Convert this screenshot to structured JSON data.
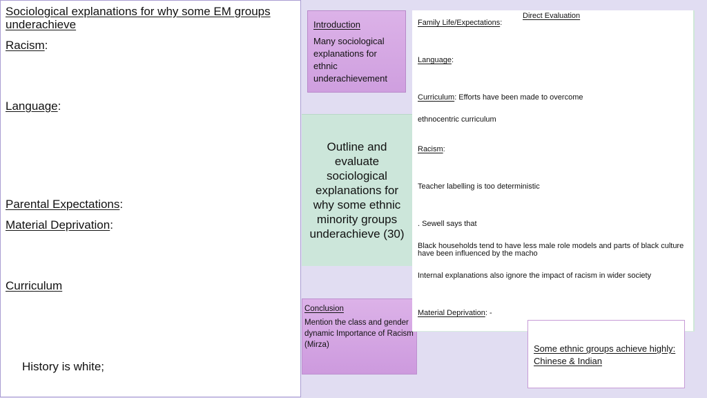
{
  "left_panel": {
    "title": "Sociological explanations for why some EM groups underachieve",
    "sections": [
      {
        "label": "Racism",
        "suffix": ":"
      },
      {
        "label": "Language",
        "suffix": ":"
      },
      {
        "label": "Parental Expectations",
        "suffix": ":"
      },
      {
        "label": "Material Deprivation",
        "suffix": ":"
      },
      {
        "label": "Curriculum",
        "suffix": ""
      }
    ],
    "note": "History is white;"
  },
  "introduction": {
    "title": "Introduction",
    "body": "Many sociological explanations for ethnic underachievement"
  },
  "question": {
    "text": "Outline and evaluate sociological explanations for why some ethnic minority groups underachieve (30)"
  },
  "conclusion": {
    "title": "Conclusion",
    "body": "Mention the class and gender dynamic Importance of Racism (Mirza)"
  },
  "evaluation": {
    "heading": "Direct Evaluation",
    "family_label": "Family Life/Expectations",
    "family_suffix": ":",
    "language_label": "Language",
    "language_suffix": ":",
    "curriculum_label": "Curriculum",
    "curriculum_text": ": Efforts have been made to overcome",
    "curriculum_cont": "ethnocentric curriculum",
    "racism_label": "Racism",
    "racism_suffix": ":",
    "teacher_text": "Teacher labelling is too deterministic",
    "sewell_text": ". Sewell says that",
    "black_text": "Black households tend to have less male role models and parts of black culture have been influenced by the macho",
    "internal_text": "Internal explanations also ignore the impact of racism in wider society",
    "material_label": "Material Deprivation",
    "material_suffix": ": -"
  },
  "achieve_box": {
    "text": "Some ethnic groups achieve highly: Chinese & Indian"
  },
  "colors": {
    "background": "#e1ddf2",
    "purple_box": "#d4a6e4",
    "green_box": "#cce6da"
  }
}
